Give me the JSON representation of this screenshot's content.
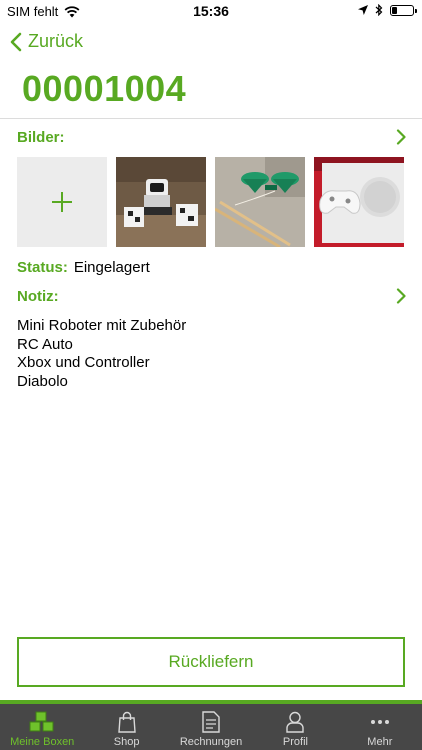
{
  "status_bar": {
    "carrier": "SIM fehlt",
    "time": "15:36",
    "battery_level": 0.25
  },
  "nav": {
    "back_label": "Zurück"
  },
  "box": {
    "id": "00001004"
  },
  "images_section": {
    "label": "Bilder:",
    "photos": [
      {
        "icon": "robot-toy-photo"
      },
      {
        "icon": "diabolo-photo"
      },
      {
        "icon": "xbox-photo"
      }
    ]
  },
  "status": {
    "label": "Status:",
    "value": "Eingelagert"
  },
  "notes": {
    "label": "Notiz:",
    "lines": [
      "Mini Roboter mit Zubehör",
      "RC Auto",
      "Xbox und Controller",
      "Diabolo"
    ]
  },
  "actions": {
    "return_label": "Rückliefern"
  },
  "tabbar": {
    "tabs": [
      {
        "label": "Meine Boxen",
        "icon": "boxes-icon",
        "active": true
      },
      {
        "label": "Shop",
        "icon": "shopping-bag-icon"
      },
      {
        "label": "Rechnungen",
        "icon": "invoice-icon"
      },
      {
        "label": "Profil",
        "icon": "profile-icon"
      },
      {
        "label": "Mehr",
        "icon": "more-icon"
      }
    ]
  },
  "colors": {
    "accent": "#58a922",
    "tabbar_bg": "#474747"
  }
}
